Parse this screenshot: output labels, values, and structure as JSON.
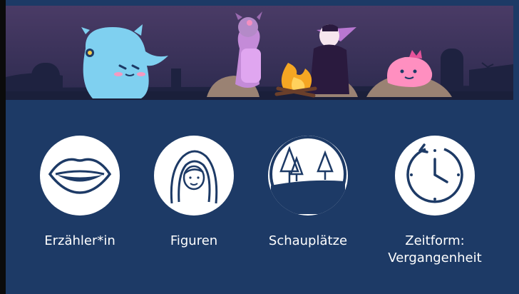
{
  "topics": [
    {
      "label": "Erzähler*in",
      "icon": "lips-icon"
    },
    {
      "label": "Figuren",
      "icon": "hooded-person-icon"
    },
    {
      "label": "Schauplätze",
      "icon": "forest-landscape-icon"
    },
    {
      "label": "Zeitform:\nVergangenheit",
      "label_line1": "Zeitform:",
      "label_line2": "Vergangenheit",
      "icon": "clock-icon"
    }
  ],
  "colors": {
    "background": "#1d3a66",
    "icon_circle": "#ffffff",
    "icon_stroke": "#1d3a66",
    "sky": "#3b2f5a",
    "ghost": "#7fd0f0",
    "devil": "#d79be6",
    "blob": "#ff8fc0",
    "fire": "#f5a623"
  }
}
